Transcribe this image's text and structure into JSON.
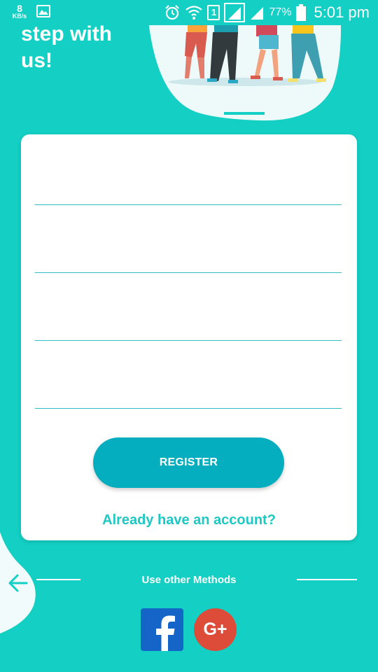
{
  "status_bar": {
    "speed_value": "8",
    "speed_unit": "KB/s",
    "sim_label": "1",
    "battery_percent": "77%",
    "time": "5:01 pm"
  },
  "header": {
    "title_line1": "step with",
    "title_line2": "us!"
  },
  "form": {
    "fields": [
      {
        "value": "",
        "placeholder": ""
      },
      {
        "value": "",
        "placeholder": ""
      },
      {
        "value": "",
        "placeholder": ""
      },
      {
        "value": "",
        "placeholder": ""
      }
    ],
    "register_label": "REGISTER",
    "login_link": "Already have an account?"
  },
  "footer": {
    "other_methods": "Use other Methods",
    "facebook_icon": "facebook-icon",
    "google_plus_label": "G+"
  },
  "colors": {
    "background": "#13cfc4",
    "accent_button": "#04aebf",
    "link": "#1ec8c3",
    "facebook": "#1565c9",
    "google_plus": "#dd4b39"
  }
}
